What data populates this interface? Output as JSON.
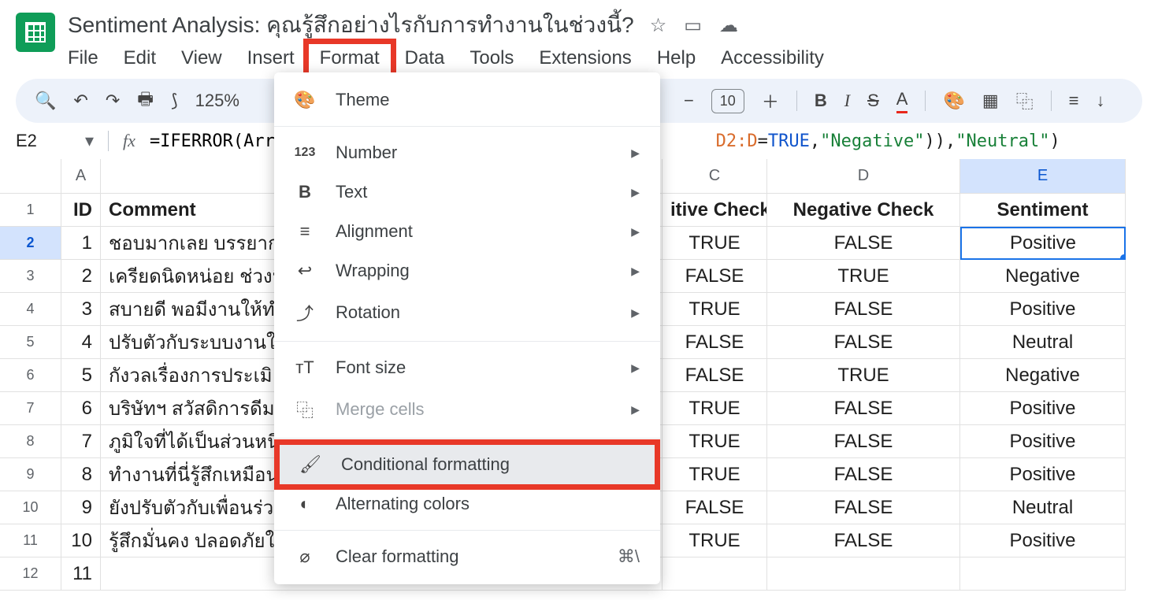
{
  "header": {
    "doc_title": "Sentiment Analysis: คุณรู้สึกอย่างไรกับการทำงานในช่วงนี้?",
    "menus": [
      "File",
      "Edit",
      "View",
      "Insert",
      "Format",
      "Data",
      "Tools",
      "Extensions",
      "Help",
      "Accessibility"
    ]
  },
  "toolbar": {
    "zoom": "125%",
    "font_size": "10"
  },
  "formula_bar": {
    "cell_ref": "E2",
    "formula_prefix": "=IFERROR(Arra",
    "formula_mid_range": "D2:D",
    "formula_eq": "=",
    "formula_bool": "TRUE",
    "formula_str1": "\"Negative\"",
    "formula_str2": "\"Neutral\""
  },
  "sheet": {
    "columns": [
      "A",
      "",
      "C",
      "D",
      "E"
    ],
    "header_row": [
      "ID",
      "Comment",
      "itive Check",
      "Negative Check",
      "Sentiment"
    ],
    "rows": [
      {
        "n": 1,
        "id": 1,
        "comment": "ชอบมากเลย บรรยาก",
        "c": "TRUE",
        "d": "FALSE",
        "e": "Positive"
      },
      {
        "n": 2,
        "id": 2,
        "comment": "เครียดนิดหน่อย ช่วงนี",
        "c": "FALSE",
        "d": "TRUE",
        "e": "Negative"
      },
      {
        "n": 3,
        "id": 3,
        "comment": "สบายดี พอมีงานให้ทำ",
        "c": "TRUE",
        "d": "FALSE",
        "e": "Positive"
      },
      {
        "n": 4,
        "id": 4,
        "comment": "ปรับตัวกับระบบงานใ",
        "c": "FALSE",
        "d": "FALSE",
        "e": "Neutral"
      },
      {
        "n": 5,
        "id": 5,
        "comment": "กังวลเรื่องการประเมิ",
        "c": "FALSE",
        "d": "TRUE",
        "e": "Negative"
      },
      {
        "n": 6,
        "id": 6,
        "comment": "บริษัทฯ สวัสดิการดีม",
        "c": "TRUE",
        "d": "FALSE",
        "e": "Positive"
      },
      {
        "n": 7,
        "id": 7,
        "comment": "ภูมิใจที่ได้เป็นส่วนหนึ",
        "c": "TRUE",
        "d": "FALSE",
        "e": "Positive"
      },
      {
        "n": 8,
        "id": 8,
        "comment": "ทำงานที่นี่รู้สึกเหมือน",
        "c": "TRUE",
        "d": "FALSE",
        "e": "Positive"
      },
      {
        "n": 9,
        "id": 9,
        "comment": "ยังปรับตัวกับเพื่อนร่ว",
        "c": "FALSE",
        "d": "FALSE",
        "e": "Neutral"
      },
      {
        "n": 10,
        "id": 10,
        "comment": "รู้สึกมั่นคง ปลอดภัยใ",
        "c": "TRUE",
        "d": "FALSE",
        "e": "Positive"
      },
      {
        "n": 11,
        "id": 11,
        "comment": "",
        "c": "",
        "d": "",
        "e": ""
      }
    ]
  },
  "dropdown": {
    "theme": "Theme",
    "number": "Number",
    "text": "Text",
    "alignment": "Alignment",
    "wrapping": "Wrapping",
    "rotation": "Rotation",
    "font_size": "Font size",
    "merge_cells": "Merge cells",
    "conditional_formatting": "Conditional formatting",
    "alternating_colors": "Alternating colors",
    "clear_formatting": "Clear formatting",
    "clear_shortcut": "⌘\\"
  }
}
